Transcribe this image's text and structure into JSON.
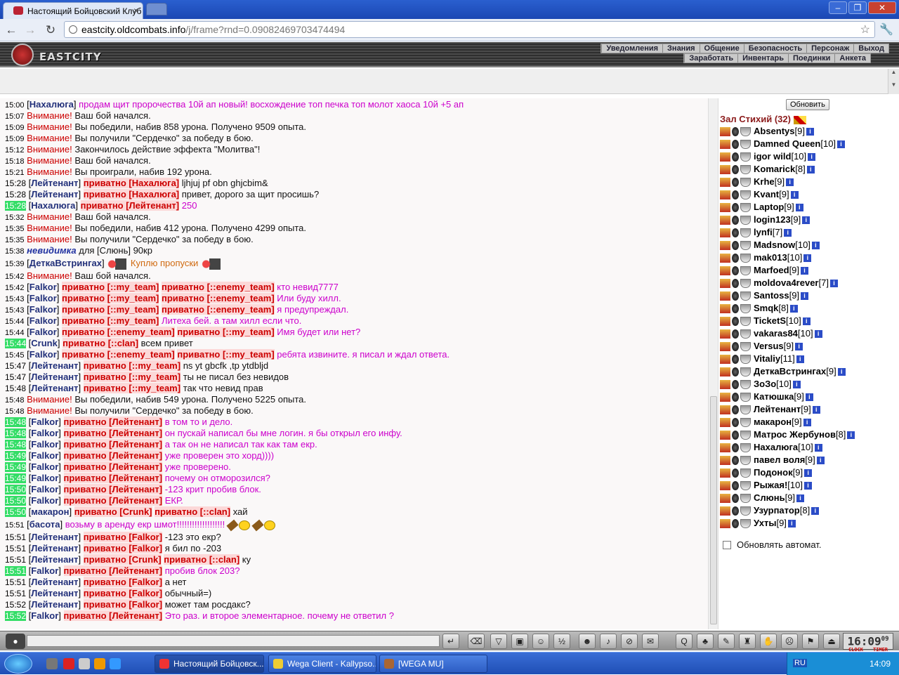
{
  "browser": {
    "tab_title": "Настоящий Бойцовский Клуб",
    "url_host": "eastcity.oldcombats.info",
    "url_path": "/j/frame?rnd=0.09082469703474494"
  },
  "game": {
    "logo": "EASTCITY",
    "menu_top": [
      "Уведомления",
      "Знания",
      "Общение",
      "Безопасность",
      "Персонаж",
      "Выход"
    ],
    "menu_bottom": [
      "Заработать",
      "Инвентарь",
      "Поединки",
      "Анкета"
    ]
  },
  "chat": [
    {
      "time": "15:00",
      "nick": "Нахалюга",
      "priv": [],
      "text": "продам щит пророчества 10й ап новый! восхождение топ печка топ молот хаоса 10й +5 ап",
      "style": "pink"
    },
    {
      "time": "15:07",
      "alert": "Внимание!",
      "text": "Ваш бой начался."
    },
    {
      "time": "15:09",
      "alert": "Внимание!",
      "text": "Вы победили, набив 858 урона. Получено 9509 опыта."
    },
    {
      "time": "15:09",
      "alert": "Внимание!",
      "text": "Вы получили \"Сердечко\" за победу в бою."
    },
    {
      "time": "15:12",
      "alert": "Внимание!",
      "text": "Закончилось действие эффекта \"Молитва\"!"
    },
    {
      "time": "15:18",
      "alert": "Внимание!",
      "text": "Ваш бой начался."
    },
    {
      "time": "15:21",
      "alert": "Внимание!",
      "text": "Вы проиграли, набив 192 урона."
    },
    {
      "time": "15:28",
      "nick": "Лейтенант",
      "priv": [
        "приватно [Нахалюга]"
      ],
      "text": "ljhjuj pf obn ghjcbim&"
    },
    {
      "time": "15:28",
      "nick": "Лейтенант",
      "priv": [
        "приватно [Нахалюга]"
      ],
      "text": "привет, дорого за щит просишь?"
    },
    {
      "time": "15:28",
      "green": true,
      "nick": "Нахалюга",
      "priv": [
        "приватно [Лейтенант]"
      ],
      "text": "250",
      "style": "pink"
    },
    {
      "time": "15:32",
      "alert": "Внимание!",
      "text": "Ваш бой начался."
    },
    {
      "time": "15:35",
      "alert": "Внимание!",
      "text": "Вы победили, набив 412 урона. Получено 4299 опыта."
    },
    {
      "time": "15:35",
      "alert": "Внимание!",
      "text": "Вы получили \"Сердечко\" за победу в бою."
    },
    {
      "time": "15:38",
      "invis": "невидимка",
      "text": "для [Слюнь] 90кр"
    },
    {
      "time": "15:39",
      "nick": "ДеткаВстрингах",
      "priv": [],
      "text": "Куплю пропуски",
      "style": "orange",
      "emoji": true
    },
    {
      "time": "15:42",
      "alert": "Внимание!",
      "text": "Ваш бой начался."
    },
    {
      "time": "15:42",
      "nick": "Falkor",
      "priv": [
        "приватно [::my_team]",
        "приватно [::enemy_team]"
      ],
      "text": "кто невид7777",
      "style": "pink"
    },
    {
      "time": "15:43",
      "nick": "Falkor",
      "priv": [
        "приватно [::my_team]",
        "приватно [::enemy_team]"
      ],
      "text": "Или буду хилл.",
      "style": "pink"
    },
    {
      "time": "15:43",
      "nick": "Falkor",
      "priv": [
        "приватно [::my_team]",
        "приватно [::enemy_team]"
      ],
      "text": "я предупреждал.",
      "style": "pink"
    },
    {
      "time": "15:44",
      "nick": "Falkor",
      "priv": [
        "приватно [::my_team]"
      ],
      "text": "Литеха бей. а там хилл если что.",
      "style": "pink"
    },
    {
      "time": "15:44",
      "nick": "Falkor",
      "priv": [
        "приватно [::enemy_team]",
        "приватно [::my_team]"
      ],
      "text": "Имя будет или нет?",
      "style": "pink"
    },
    {
      "time": "15:44",
      "green": true,
      "nick": "Crunk",
      "priv": [
        "приватно [::clan]"
      ],
      "text": "всем привет"
    },
    {
      "time": "15:45",
      "nick": "Falkor",
      "priv": [
        "приватно [::enemy_team]",
        "приватно [::my_team]"
      ],
      "text": "ребята извините. я писал и ждал ответа.",
      "style": "pink"
    },
    {
      "time": "15:47",
      "nick": "Лейтенант",
      "priv": [
        "приватно [::my_team]"
      ],
      "text": "ns yt gbcfk ,tp ytdbljd"
    },
    {
      "time": "15:47",
      "nick": "Лейтенант",
      "priv": [
        "приватно [::my_team]"
      ],
      "text": "ты не писал без невидов"
    },
    {
      "time": "15:48",
      "nick": "Лейтенант",
      "priv": [
        "приватно [::my_team]"
      ],
      "text": "так что невид прав"
    },
    {
      "time": "15:48",
      "alert": "Внимание!",
      "text": "Вы победили, набив 549 урона. Получено 5225 опыта."
    },
    {
      "time": "15:48",
      "alert": "Внимание!",
      "text": "Вы получили \"Сердечко\" за победу в бою."
    },
    {
      "time": "15:48",
      "green": true,
      "nick": "Falkor",
      "priv": [
        "приватно [Лейтенант]"
      ],
      "text": "в том то и дело.",
      "style": "pink"
    },
    {
      "time": "15:48",
      "green": true,
      "nick": "Falkor",
      "priv": [
        "приватно [Лейтенант]"
      ],
      "text": "он пускай написал бы мне логин. я бы открыл его инфу.",
      "style": "pink"
    },
    {
      "time": "15:48",
      "green": true,
      "nick": "Falkor",
      "priv": [
        "приватно [Лейтенант]"
      ],
      "text": "а так он не написал так как там екр.",
      "style": "pink"
    },
    {
      "time": "15:49",
      "green": true,
      "nick": "Falkor",
      "priv": [
        "приватно [Лейтенант]"
      ],
      "text": "уже проверен это хорд))))",
      "style": "pink"
    },
    {
      "time": "15:49",
      "green": true,
      "nick": "Falkor",
      "priv": [
        "приватно [Лейтенант]"
      ],
      "text": "уже проверено.",
      "style": "pink"
    },
    {
      "time": "15:49",
      "green": true,
      "nick": "Falkor",
      "priv": [
        "приватно [Лейтенант]"
      ],
      "text": "почему он отморозился?",
      "style": "pink"
    },
    {
      "time": "15:50",
      "green": true,
      "nick": "Falkor",
      "priv": [
        "приватно [Лейтенант]"
      ],
      "text": "-123 крит пробив блок.",
      "style": "pink"
    },
    {
      "time": "15:50",
      "green": true,
      "nick": "Falkor",
      "priv": [
        "приватно [Лейтенант]"
      ],
      "text": "ЕКР.",
      "style": "pink"
    },
    {
      "time": "15:50",
      "green": true,
      "nick": "макарон",
      "priv": [
        "приватно [Crunk]",
        "приватно [::clan]"
      ],
      "text": "хай"
    },
    {
      "time": "15:51",
      "nick": "басота",
      "priv": [],
      "text": "возьму в аренду екр шмот!!!!!!!!!!!!!!!!!!!",
      "style": "pink",
      "smiles": true
    },
    {
      "time": "15:51",
      "nick": "Лейтенант",
      "priv": [
        "приватно [Falkor]"
      ],
      "text": "-123 это екр?"
    },
    {
      "time": "15:51",
      "nick": "Лейтенант",
      "priv": [
        "приватно [Falkor]"
      ],
      "text": "я бил по -203"
    },
    {
      "time": "15:51",
      "nick": "Лейтенант",
      "priv": [
        "приватно [Crunk]",
        "приватно [::clan]"
      ],
      "text": "ку"
    },
    {
      "time": "15:51",
      "green": true,
      "nick": "Falkor",
      "priv": [
        "приватно [Лейтенант]"
      ],
      "text": "пробив блок 203?",
      "style": "pink"
    },
    {
      "time": "15:51",
      "nick": "Лейтенант",
      "priv": [
        "приватно [Falkor]"
      ],
      "text": "а нет"
    },
    {
      "time": "15:51",
      "nick": "Лейтенант",
      "priv": [
        "приватно [Falkor]"
      ],
      "text": "обычный=)"
    },
    {
      "time": "15:52",
      "nick": "Лейтенант",
      "priv": [
        "приватно [Falkor]"
      ],
      "text": "может там росдакс?"
    },
    {
      "time": "15:52",
      "green": true,
      "nick": "Falkor",
      "priv": [
        "приватно [Лейтенант]"
      ],
      "text": "Это раз. и второе элементарное. почему не ответил ?",
      "style": "pink"
    }
  ],
  "sidebar": {
    "refresh_label": "Обновить",
    "room": "Зал Стихий (32)",
    "auto_refresh": "Обновлять автомат.",
    "users": [
      {
        "name": "Absentys",
        "level": "[9]"
      },
      {
        "name": "Damned Queen",
        "level": "[10]"
      },
      {
        "name": "igor wild",
        "level": "[10]"
      },
      {
        "name": "Komarick",
        "level": "[8]"
      },
      {
        "name": "Krhe",
        "level": "[9]"
      },
      {
        "name": "Kvant",
        "level": "[9]"
      },
      {
        "name": "Laptop",
        "level": "[9]"
      },
      {
        "name": "login123",
        "level": "[9]"
      },
      {
        "name": "lynfi",
        "level": "[7]"
      },
      {
        "name": "Madsnow",
        "level": "[10]"
      },
      {
        "name": "mak013",
        "level": "[10]"
      },
      {
        "name": "Marfoed",
        "level": "[9]"
      },
      {
        "name": "moldova4rever",
        "level": "[7]"
      },
      {
        "name": "Santoss",
        "level": "[9]"
      },
      {
        "name": "Smqk",
        "level": "[8]"
      },
      {
        "name": "TicketS",
        "level": "[10]"
      },
      {
        "name": "vakaras84",
        "level": "[10]"
      },
      {
        "name": "Versus",
        "level": "[9]"
      },
      {
        "name": "Vitaliy",
        "level": "[11]"
      },
      {
        "name": "ДеткаВстрингах",
        "level": "[9]"
      },
      {
        "name": "ЗоЗо",
        "level": "[10]"
      },
      {
        "name": "Катюшка",
        "level": "[9]"
      },
      {
        "name": "Лейтенант",
        "level": "[9]"
      },
      {
        "name": "макарон",
        "level": "[9]"
      },
      {
        "name": "Матрос Жербунов",
        "level": "[8]"
      },
      {
        "name": "Нахалюга",
        "level": "[10]"
      },
      {
        "name": "павел воля",
        "level": "[9]"
      },
      {
        "name": "Подонок",
        "level": "[9]"
      },
      {
        "name": "Рыжая!",
        "level": "[10]"
      },
      {
        "name": "Слюнь",
        "level": "[9]"
      },
      {
        "name": "Узурпатор",
        "level": "[8]"
      },
      {
        "name": "Ухты",
        "level": "[9]"
      }
    ]
  },
  "clock": {
    "time": "16:09",
    "seconds": "09",
    "label_left": "CLOCK",
    "label_right": "TIMER"
  },
  "taskbar": {
    "tasks": [
      "Настоящий Бойцовск...",
      "Wega Client - Kallypso...",
      "[WEGA MU]"
    ],
    "lang": "RU",
    "time": "14:09"
  },
  "colors": {
    "alert": "#cc0000",
    "private": "#cc0000",
    "green_time": "#33dd66",
    "pink_text": "#cc00cc",
    "nick": "#22307a"
  }
}
